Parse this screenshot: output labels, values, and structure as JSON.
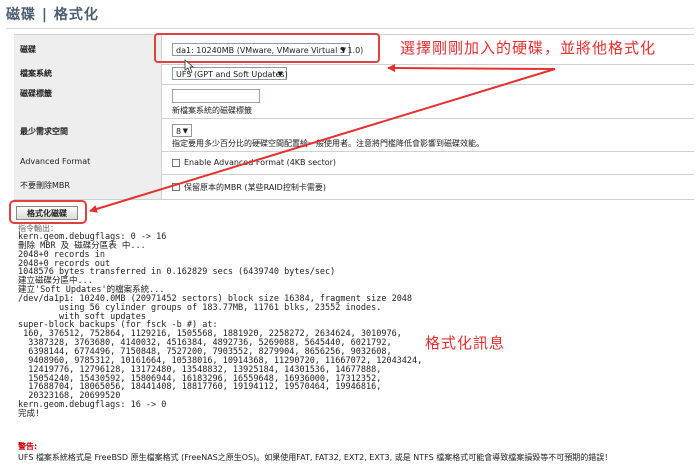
{
  "page": {
    "title": "磁碟 | 格式化"
  },
  "form": {
    "disk": {
      "label": "磁碟",
      "selected": "da1: 10240MB (VMware, VMware Virtual S 1.0)"
    },
    "fs": {
      "label": "檔案系統",
      "selected": "UFS (GPT and Soft Updates)"
    },
    "volume_label": {
      "label": "磁碟標籤",
      "value": "",
      "help": "新檔案系統的磁碟標籤"
    },
    "min_free": {
      "label": "最少需求空間",
      "selected": "8",
      "help": "指定要用多少百分比的硬碟空間配置給一般使用者。注意將門檻降低會影響到磁碟效能。"
    },
    "advanced": {
      "label": "Advanced Format",
      "checkbox_label": "Enable Advanced Format (4KB sector)",
      "checked": false
    },
    "keep_mbr": {
      "label": "不要刪除MBR",
      "checkbox_label": "保留原本的MBR (某些RAID控制卡需要)",
      "checked": false
    }
  },
  "actions": {
    "format_button": "格式化磁碟"
  },
  "output": {
    "label": "指令輸出：",
    "lines": [
      "kern.geom.debugflags: 0 -> 16",
      "刪除 MBR 及 磁碟分區表 中...",
      "2048+0 records in",
      "2048+0 records out",
      "1048576 bytes transferred in 0.162829 secs (6439740 bytes/sec)",
      "建立磁碟分區中...",
      "建立'Soft Updates'的檔案系統...",
      "/dev/da1p1: 10240.0MB (20971452 sectors) block size 16384, fragment size 2048",
      "        using 56 cylinder groups of 183.77MB, 11761 blks, 23552 inodes.",
      "        with soft updates",
      "super-block backups (for fsck -b #) at:",
      " 160, 376512, 752864, 1129216, 1505568, 1881920, 2258272, 2634624, 3010976,",
      "  3387328, 3763680, 4140032, 4516384, 4892736, 5269088, 5645440, 6021792,",
      "  6398144, 6774496, 7150848, 7527200, 7903552, 8279904, 8656256, 9032608,",
      "  9408960, 9785312, 10161664, 10538016, 10914368, 11290720, 11667072, 12043424,",
      "  12419776, 12796128, 13172480, 13548832, 13925184, 14301536, 14677888,",
      "  15054240, 15430592, 15806944, 16183296, 16559648, 16936000, 17312352,",
      "  17688704, 18065056, 18441408, 18817760, 19194112, 19570464, 19946816,",
      "  20323168, 20699520",
      "kern.geom.debugflags: 16 -> 0",
      "完成!"
    ]
  },
  "warning": {
    "label": "警告:",
    "text": "UFS 檔案系統格式是 FreeBSD 原生檔案格式 (FreeNAS之原生OS)。如果使用FAT, FAT32, EXT2, EXT3, 或是 NTFS 檔案格式可能會導致檔案損毀等不可預期的錯誤！"
  },
  "annotations": {
    "select_disk": "選擇剛剛加入的硬碟，並將他格式化",
    "format_info": "格式化訊息"
  },
  "colors": {
    "annotation": "#e53030",
    "title": "#4c5e72"
  }
}
